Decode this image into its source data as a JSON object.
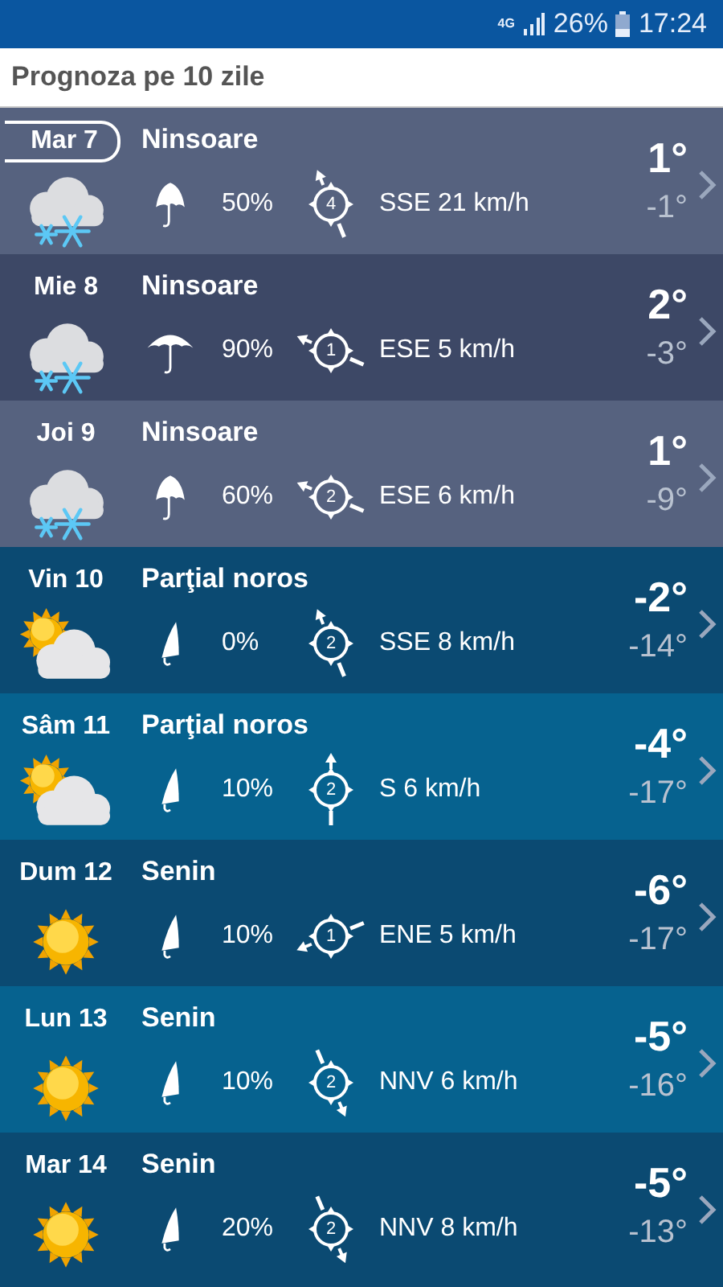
{
  "status_bar": {
    "network": "4G",
    "battery": "26%",
    "time": "17:24"
  },
  "header": {
    "title": "Prognoza pe 10 zile"
  },
  "days": [
    {
      "day": "Mar 7",
      "selected": true,
      "condition": "Ninsoare",
      "kind": "snow",
      "umbrella": {
        "kind": "half"
      },
      "precip": "50%",
      "wind_force": "4",
      "arrow": {
        "kind": "NNW"
      },
      "wind": "SSE 21 km/h",
      "high": "1°",
      "low": "-1°"
    },
    {
      "day": "Mie 8",
      "selected": false,
      "condition": "Ninsoare",
      "kind": "snow",
      "umbrella": {
        "kind": "open"
      },
      "precip": "90%",
      "wind_force": "1",
      "arrow": {
        "kind": "WNW"
      },
      "wind": "ESE 5 km/h",
      "high": "2°",
      "low": "-3°"
    },
    {
      "day": "Joi 9",
      "selected": false,
      "condition": "Ninsoare",
      "kind": "snow",
      "umbrella": {
        "kind": "half"
      },
      "precip": "60%",
      "wind_force": "2",
      "arrow": {
        "kind": "WNW"
      },
      "wind": "ESE 6 km/h",
      "high": "1°",
      "low": "-9°"
    },
    {
      "day": "Vin 10",
      "selected": false,
      "condition": "Parţial noros",
      "kind": "partly",
      "umbrella": {
        "kind": "closed"
      },
      "precip": "0%",
      "wind_force": "2",
      "arrow": {
        "kind": "NNW"
      },
      "wind": "SSE 8 km/h",
      "high": "-2°",
      "low": "-14°"
    },
    {
      "day": "Sâm 11",
      "selected": false,
      "condition": "Parţial noros",
      "kind": "partly",
      "umbrella": {
        "kind": "closed"
      },
      "precip": "10%",
      "wind_force": "2",
      "arrow": {
        "kind": "N"
      },
      "wind": "S 6 km/h",
      "high": "-4°",
      "low": "-17°"
    },
    {
      "day": "Dum 12",
      "selected": false,
      "condition": "Senin",
      "kind": "sunny",
      "umbrella": {
        "kind": "closed"
      },
      "precip": "10%",
      "wind_force": "1",
      "arrow": {
        "kind": "WSW"
      },
      "wind": "ENE 5 km/h",
      "high": "-6°",
      "low": "-17°"
    },
    {
      "day": "Lun 13",
      "selected": false,
      "condition": "Senin",
      "kind": "sunny",
      "umbrella": {
        "kind": "closed"
      },
      "precip": "10%",
      "wind_force": "2",
      "arrow": {
        "kind": "SSE"
      },
      "wind": "NNV 6 km/h",
      "high": "-5°",
      "low": "-16°"
    },
    {
      "day": "Mar 14",
      "selected": false,
      "condition": "Senin",
      "kind": "sunny",
      "umbrella": {
        "kind": "closed"
      },
      "precip": "20%",
      "wind_force": "2",
      "arrow": {
        "kind": "SSE"
      },
      "wind": "NNV 8 km/h",
      "high": "-5°",
      "low": "-13°"
    }
  ]
}
